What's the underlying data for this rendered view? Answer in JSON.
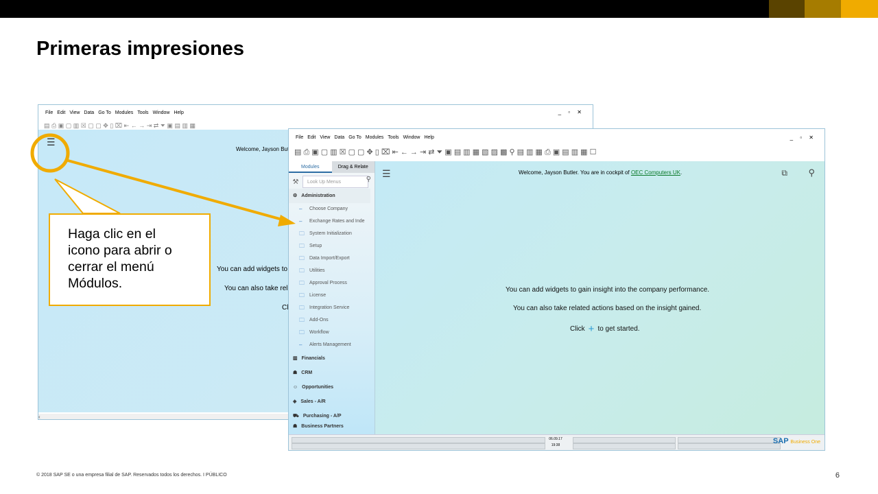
{
  "slide": {
    "title": "Primeras impresiones",
    "footer": "© 2018 SAP SE o una empresa filial de SAP. Reservados todos los derechos.  I    PÚBLICO",
    "page_number": "6",
    "accent_colors": [
      "#5a4300",
      "#a67c00",
      "#f0ab00"
    ]
  },
  "menu": [
    "File",
    "Edit",
    "View",
    "Data",
    "Go To",
    "Modules",
    "Tools",
    "Window",
    "Help"
  ],
  "back_window": {
    "welcome": "Welcome, Jayson Butl",
    "line1": "You can add widgets to",
    "line2": "You can also take rel",
    "line3": "Cl"
  },
  "front_window": {
    "tabs": [
      "Modules",
      "Drag & Relate"
    ],
    "lookup_placeholder": "Look Up Menus",
    "section_admin": "Administration",
    "admin_items": [
      {
        "label": "Choose Company",
        "icon": "dash"
      },
      {
        "label": "Exchange Rates and Inde",
        "icon": "dash"
      },
      {
        "label": "System Initialization",
        "icon": "folder"
      },
      {
        "label": "Setup",
        "icon": "folder"
      },
      {
        "label": "Data Import/Export",
        "icon": "folder"
      },
      {
        "label": "Utilities",
        "icon": "folder"
      },
      {
        "label": "Approval Process",
        "icon": "folder"
      },
      {
        "label": "License",
        "icon": "folder"
      },
      {
        "label": "Integration Service",
        "icon": "folder"
      },
      {
        "label": "Add-Ons",
        "icon": "folder"
      },
      {
        "label": "Workflow",
        "icon": "folder"
      },
      {
        "label": "Alerts Management",
        "icon": "dash"
      }
    ],
    "sections": [
      "Financials",
      "CRM",
      "Opportunities",
      "Sales - A/R",
      "Purchasing - A/P",
      "Business Partners"
    ],
    "welcome_prefix": "Welcome, Jayson Butler. You are in cockpit of ",
    "company_link": "OEC Computers UK",
    "welcome_suffix": ".",
    "line1": "You can add widgets to gain insight into the company performance.",
    "line2": "You can also take related actions based on the insight gained.",
    "line3_a": "Click",
    "line3_b": "to get started.",
    "status_date": "06.09.17",
    "status_time": "19:38",
    "logo": "SAP",
    "logo_sub": "Business One"
  },
  "callout": {
    "text_lines": [
      "Haga clic en el",
      "icono para abrir o",
      "cerrar el menú",
      "Módulos."
    ],
    "color": "#f0ab00"
  }
}
